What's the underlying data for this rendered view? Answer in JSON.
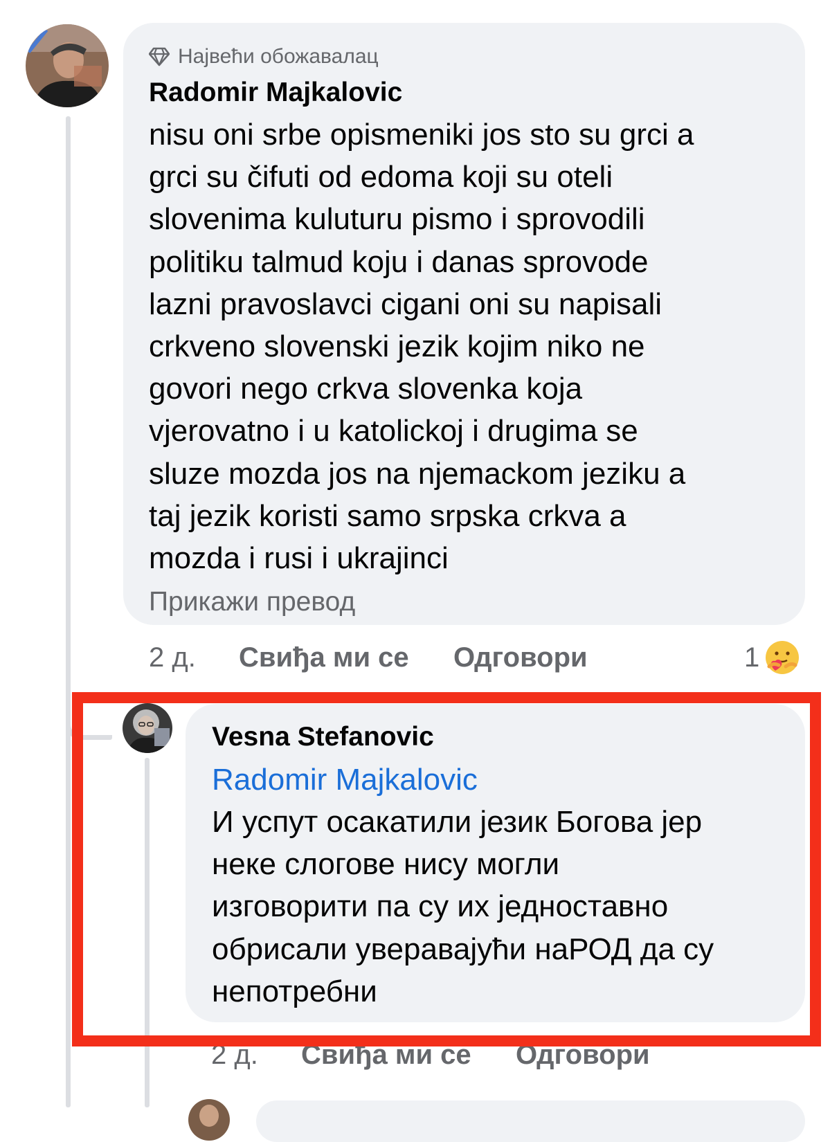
{
  "comment": {
    "badge": "Највећи обожавалац",
    "badge_icon": "diamond-icon",
    "author": "Radomir Majkalovic",
    "text": "nisu oni srbe opismeniki jos sto su grci a\ngrci su čifuti od edoma koji su oteli\nslovenima kuluturu pismo i sprovodili\npolitiku talmud koju i danas sprovode\nlazni pravoslavci cigani oni su napisali\ncrkveno slovenski jezik kojim niko ne\ngovori nego crkva slovenka koja\nvjerovatno i u katolickoj i drugima se\nsluze mozda jos na njemackom jeziku a\ntaj jezik koristi samo srpska crkva a\nmozda i rusi i ukrajinci",
    "translate_link": "Прикажи превод",
    "time": "2 д.",
    "like_label": "Свиђа ми се",
    "reply_label": "Одговори",
    "reaction_count": "1",
    "reaction_icon": "care-emoji-icon"
  },
  "reply": {
    "author": "Vesna Stefanovic",
    "mention": "Radomir Majkalovic",
    "text": "И успут осакатили језик Богова јер\nнеке слогове нису могли\nизговорити па су их једноставно\nобрисали уверавајући наРОД да су\nнепотребни",
    "time": "2 д.",
    "like_label": "Свиђа ми се",
    "reply_label": "Одговори"
  },
  "colors": {
    "bubble": "#f0f2f5",
    "mention": "#1a6ed8",
    "meta": "#65676b",
    "highlight": "#f32f1a"
  }
}
